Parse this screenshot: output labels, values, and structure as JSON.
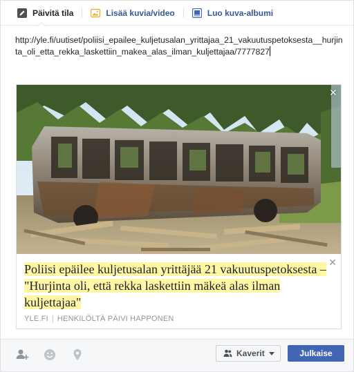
{
  "tabs": [
    {
      "label": "Päivitä tila",
      "icon": "pencil-icon",
      "active": true
    },
    {
      "label": "Lisää kuvia/video",
      "icon": "photo-icon",
      "active": false
    },
    {
      "label": "Luo kuva-albumi",
      "icon": "album-icon",
      "active": false
    }
  ],
  "status": {
    "text": "http://yle.fi/uutiset/poliisi_epailee_kuljetusalan_yrittajaa_21_vakuutuspetoksesta__hurjinta_oli_etta_rekka_laskettiin_makea_alas_ilman_kuljettajaa/7777827"
  },
  "preview": {
    "image_alt": "Burned-out bus wreck in a forest clearing",
    "title": "Poliisi epäilee kuljetusalan yrittäjää 21 vakuutuspetoksesta – \"Hurjinta oli, että rekka laskettiin mäkeä alas ilman kuljettajaa\"",
    "source": "YLE.FI",
    "author": "HENKILÖLTÄ PÄIVI HAPPONEN",
    "highlight_color": "#fff7a3"
  },
  "bottom": {
    "icons": [
      "tag-friends-icon",
      "emoji-icon",
      "location-pin-icon"
    ],
    "audience_label": "Kaverit",
    "audience_icon": "friends-icon",
    "publish_label": "Julkaise"
  },
  "colors": {
    "accent": "#4267b2",
    "link": "#365899",
    "border": "#dddfe2"
  }
}
